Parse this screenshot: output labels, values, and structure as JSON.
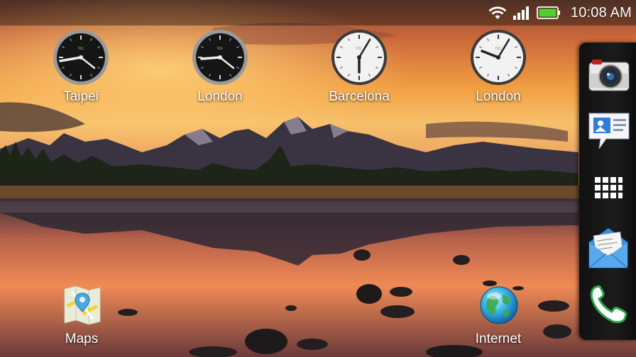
{
  "status_bar": {
    "time": "10:08 AM",
    "icons": [
      "wifi-icon",
      "signal-bars-icon",
      "battery-icon"
    ],
    "battery_color": "#4cd12f"
  },
  "clock_widgets": [
    {
      "city": "Taipei",
      "theme": "dark",
      "brand": "htc"
    },
    {
      "city": "London",
      "theme": "dark",
      "brand": "htc"
    },
    {
      "city": "Barcelona",
      "theme": "light",
      "brand": "htc"
    },
    {
      "city": "London",
      "theme": "light",
      "brand": "htc"
    }
  ],
  "apps": [
    {
      "label": "Maps",
      "icon": "maps-icon"
    },
    {
      "label": "Internet",
      "icon": "globe-icon"
    }
  ],
  "launch_bar": {
    "items": [
      "camera-icon",
      "messages-icon",
      "all-apps-icon",
      "mail-icon",
      "phone-icon"
    ]
  },
  "colors": {
    "sky_top": "#d66a2f",
    "sky_glow": "#f4b04a",
    "water": "#c86a52"
  }
}
